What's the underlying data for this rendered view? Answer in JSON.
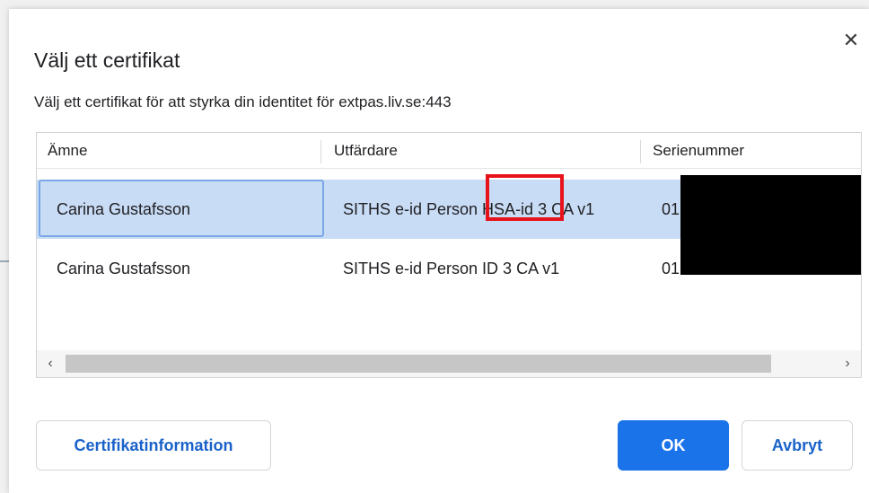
{
  "dialog": {
    "title": "Välj ett certifikat",
    "description": "Välj ett certifikat för att styrka din identitet för extpas.liv.se:443",
    "close_glyph": "✕"
  },
  "table": {
    "columns": [
      "Ämne",
      "Utfärdare",
      "Serienummer"
    ],
    "rows": [
      {
        "subject": "Carina Gustafsson",
        "issuer": "SITHS e-id Person HSA-id 3 CA v1",
        "serial": "01",
        "selected": true
      },
      {
        "subject": "Carina Gustafsson",
        "issuer": "SITHS e-id Person ID 3 CA v1",
        "serial": "01",
        "selected": false
      }
    ],
    "scroll_left_glyph": "‹",
    "scroll_right_glyph": "›"
  },
  "buttons": {
    "certificate_info": "Certifikatinformation",
    "ok": "OK",
    "cancel": "Avbryt"
  },
  "colors": {
    "accent": "#1a73e8",
    "selected_row": "#c9dcf5",
    "highlight_box": "#e8121b",
    "redaction": "#000000"
  }
}
